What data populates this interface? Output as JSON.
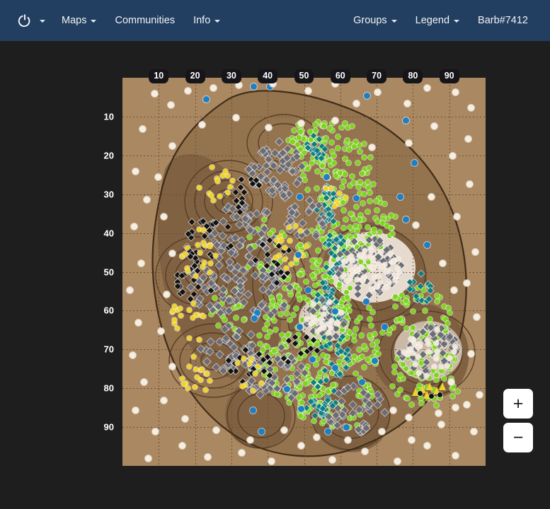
{
  "navbar": {
    "brand": {
      "icon": "power-logo-icon",
      "has_caret": true
    },
    "left_items": [
      {
        "label": "Maps",
        "caret": true
      },
      {
        "label": "Communities",
        "caret": false
      },
      {
        "label": "Info",
        "caret": true
      }
    ],
    "right_items": [
      {
        "label": "Groups",
        "caret": true
      },
      {
        "label": "Legend",
        "caret": true
      },
      {
        "label": "Barb#7412",
        "caret": false
      }
    ],
    "background_color": "#223e60",
    "text_color": "#f2f4f6"
  },
  "map": {
    "background_color": "#a98862",
    "grid_color": "#6b4a2b",
    "x_axis_labels": [
      "10",
      "20",
      "30",
      "40",
      "50",
      "60",
      "70",
      "80",
      "90"
    ],
    "y_axis_labels": [
      "10",
      "20",
      "30",
      "40",
      "50",
      "60",
      "70",
      "80",
      "90"
    ],
    "axis_badge_bg": "#15151a",
    "axis_badge_text": "#ffffff"
  },
  "zoom_controls": {
    "zoom_in_label": "+",
    "zoom_out_label": "−"
  },
  "page": {
    "background_color": "#1e1e1e"
  },
  "marker_legend": {
    "green": "#7fd41f",
    "teal": "#0c7d80",
    "gray": "#6c6c74",
    "black": "#111111",
    "white": "#f2e6d8",
    "yellow": "#f0d32a",
    "blue": "#1d7fc4",
    "cream": "#f6eee0"
  }
}
